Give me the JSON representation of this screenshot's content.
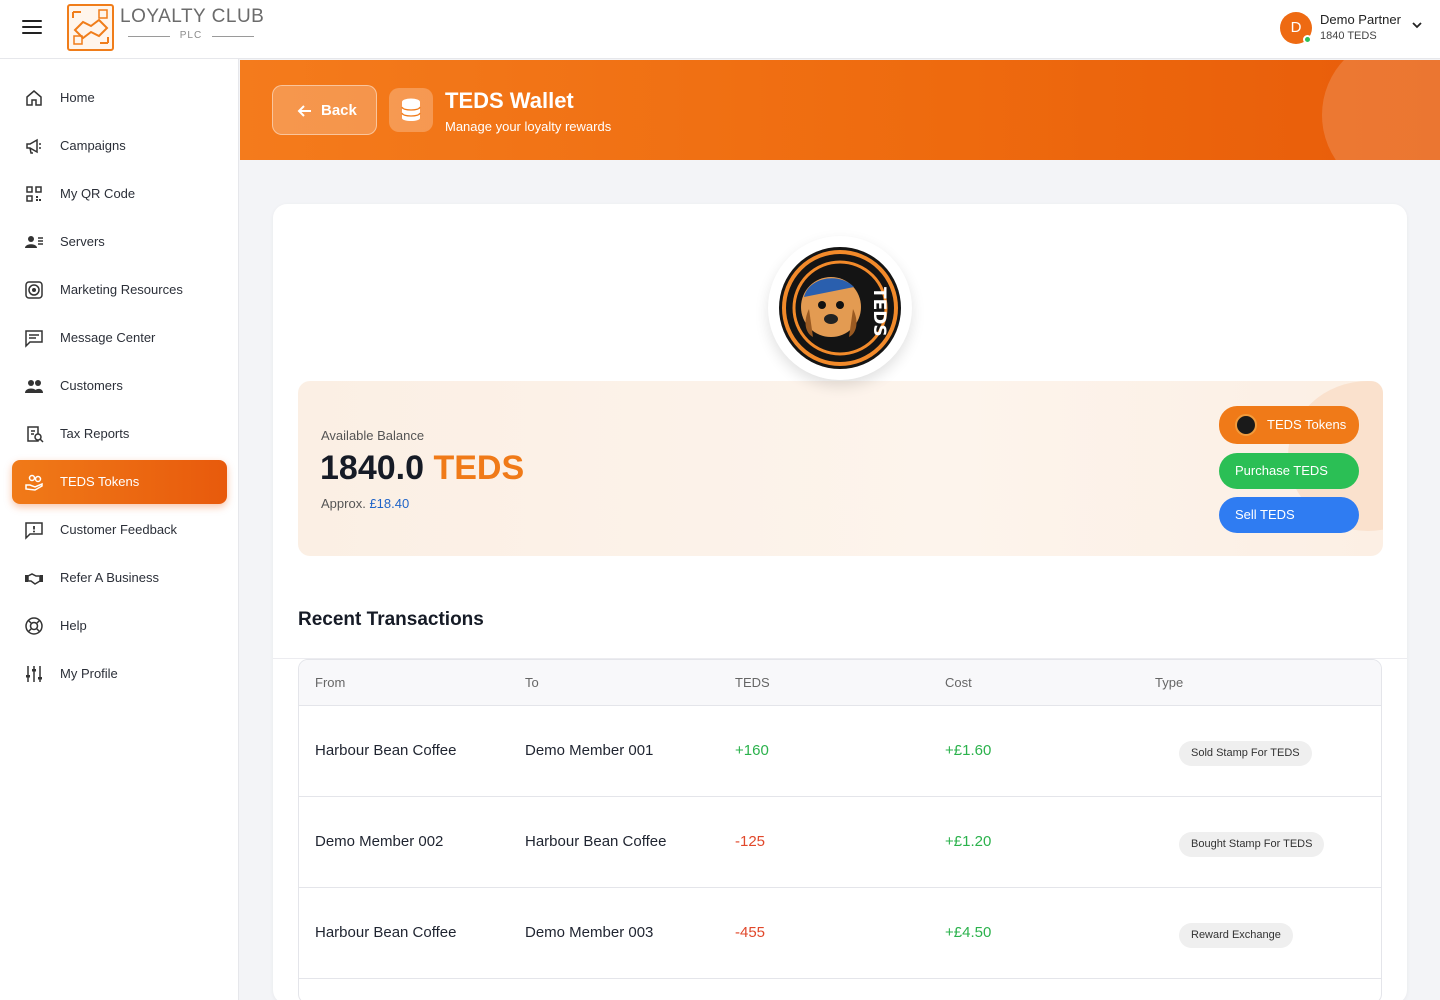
{
  "brand": {
    "name": "LOYALTY CLUB",
    "sub": "PLC"
  },
  "user": {
    "initial": "D",
    "name": "Demo Partner",
    "balance": "1840 TEDS"
  },
  "sidebar": {
    "items": [
      {
        "label": "Home",
        "icon": "home-icon"
      },
      {
        "label": "Campaigns",
        "icon": "megaphone-icon"
      },
      {
        "label": "My QR Code",
        "icon": "qr-code-icon"
      },
      {
        "label": "Servers",
        "icon": "servers-icon"
      },
      {
        "label": "Marketing Resources",
        "icon": "target-icon"
      },
      {
        "label": "Message Center",
        "icon": "message-icon"
      },
      {
        "label": "Customers",
        "icon": "customers-icon"
      },
      {
        "label": "Tax Reports",
        "icon": "tax-report-icon"
      },
      {
        "label": "TEDS Tokens",
        "icon": "tokens-hand-icon",
        "active": true
      },
      {
        "label": "Customer Feedback",
        "icon": "feedback-icon"
      },
      {
        "label": "Refer A Business",
        "icon": "handshake-icon"
      },
      {
        "label": "Help",
        "icon": "lifebuoy-icon"
      },
      {
        "label": "My Profile",
        "icon": "sliders-icon"
      }
    ]
  },
  "header": {
    "back_label": "Back",
    "title": "TEDS Wallet",
    "subtitle": "Manage your loyalty rewards"
  },
  "balance": {
    "label": "Available Balance",
    "amount": "1840.0",
    "unit": "TEDS",
    "approx_prefix": "Approx.",
    "approx_value": "£18.40",
    "buttons": {
      "tokens": "TEDS Tokens",
      "purchase": "Purchase TEDS",
      "sell": "Sell TEDS"
    }
  },
  "transactions": {
    "title": "Recent Transactions",
    "columns": [
      "From",
      "To",
      "TEDS",
      "Cost",
      "Type"
    ],
    "rows": [
      {
        "from": "Harbour Bean Coffee",
        "to": "Demo Member 001",
        "teds": "+160",
        "cost": "+£1.60",
        "type": "Sold Stamp For TEDS"
      },
      {
        "from": "Demo Member 002",
        "to": "Harbour Bean Coffee",
        "teds": "-125",
        "cost": "+£1.20",
        "type": "Bought Stamp For TEDS"
      },
      {
        "from": "Harbour Bean Coffee",
        "to": "Demo Member 003",
        "teds": "-455",
        "cost": "+£4.50",
        "type": "Reward Exchange"
      }
    ]
  },
  "colors": {
    "accent": "#f07a18",
    "green": "#2bbf55",
    "blue": "#2f7cf2",
    "negative": "#e1482b"
  }
}
